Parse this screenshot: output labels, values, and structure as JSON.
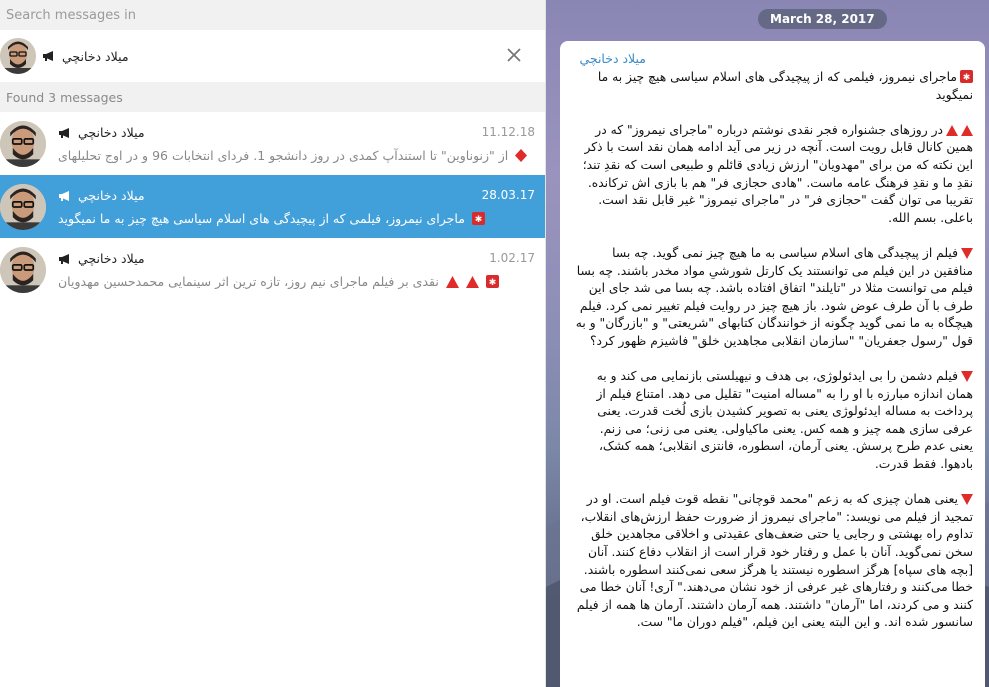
{
  "search": {
    "placeholder": "Search messages in"
  },
  "filter": {
    "chat_name": "ميلاد دخانچي"
  },
  "found_label": "Found 3 messages",
  "results": [
    {
      "name": "ميلاد دخانچي",
      "date": "11.12.18",
      "preview": "از \"زنوناوین\" تا استندآپ کمدی در روز دانشجو 1. فردای انتخابات 96 و در اوج تحلیلهای"
    },
    {
      "name": "ميلاد دخانچي",
      "date": "28.03.17",
      "preview": "ماجرای نیمروز، فیلمی که از پیچیدگی های اسلام سیاسی هیچ چیز به ما نمیگوید"
    },
    {
      "name": "ميلاد دخانچي",
      "date": "1.02.17",
      "preview": "نقدی بر فیلم ماجرای نیم روز، تازه ترین اثر سینمایی محمدحسین مهدویان"
    }
  ],
  "conversation": {
    "date_pill": "March 28, 2017",
    "author": "ميلاد دخانچي",
    "paragraphs": [
      "ماجرای نیمروز، فیلمی که از پیچیدگی های اسلام سیاسی هیچ چیز به ما نمیگوید",
      "در روزهای جشنواره فجر نقدی نوشتم درباره \"ماجرای نیمروز\" که در همین کانال قابل رویت است. آنچه در زیر می آید ادامه همان نقد است با ذکر این نکته که من برای \"مهدویان\" ارزش زیادی قائلم و طبیعی است که نقدِ تند؛ نقدِ ما و نقدِ فرهنگ عامه ماست. \"هادی حجازی فر\" هم با بازی اش ترکانده. تقریبا می توان گفت \"حجازی فر\" در \"ماجرای نیمروز\" غیر قابل نقد است. باعلی. بسم الله.",
      "فیلم از پیچیدگی های اسلام سیاسی به ما هیچ چیز نمی گوید. چه بسا منافقین در این فیلم می توانستند یک کارتل شورشیِ مواد مخدر باشند. چه بسا فیلم می توانست مثلا در \"تایلند\" اتفاق افتاده باشد. چه بسا می شد جای این طرف با آن طرف عوض شود. باز هیچ چیز در روایت فیلم تغییر نمی کرد. فیلم هیچگاه به ما نمی گوید چگونه از خوانندگان کتابهای \"شریعتی\" و \"بازرگان\" و به قول \"رسول جعفریان\" \"سازمان انقلابی مجاهدین خلق\" فاشیزم ظهور کرد؟",
      "فیلم دشمن را بی ایدئولوژی، بی هدف و نیهیلستی بازنمایی می کند و به همان اندازه مبارزه با او را به \"مساله امنیت\" تقلیل می دهد. امتناع فیلم از پرداخت به مساله ایدئولوژی یعنی به تصویر کشیدن بازی لُخت قدرت. یعنی عرفی سازی همه چیز و همه کس. یعنی ماکیاولی. یعنی می زنی؛ می زنم. یعنی عدم طرح پرسش. یعنی آرمان، اسطوره، فانتزی انقلابی؛ همه کشک، بادهوا. فقط قدرت.",
      "یعنی همان چیزی که به زعم \"محمد قوچانی\" نقطه قوت فیلم است. او در تمجید از فیلم می نویسد: \"ماجرای نیمروز از ضرورت حفظ ارزش‌های انقلاب، تداوم راه بهشتی و رجایی یا حتی ضعف‌های عقیدتی و اخلاقی مجاهدین خلق سخن نمی‌گوید. آنان با عمل و رفتار خود قرار است از انقلاب دفاع کنند. آنان [بچه های سپاه] هرگز اسطوره نیستند یا هرگز سعی نمی‌کنند اسطوره باشند. خطا می‌کنند و رفتارهای غیر عرفی از خود نشان می‌دهند.\" آری! آنان خطا می کنند و می کردند، اما \"آرمان\" داشتند. همه آرمان داشتند. آرمان ها همه از فیلم سانسور شده اند. و این البته یعنی این فیلم، \"فیلم دوران ما\" ست."
    ]
  },
  "colors": {
    "accent": "#419fd9",
    "pill": "#4f5a6a",
    "author": "#3a8bc8"
  }
}
